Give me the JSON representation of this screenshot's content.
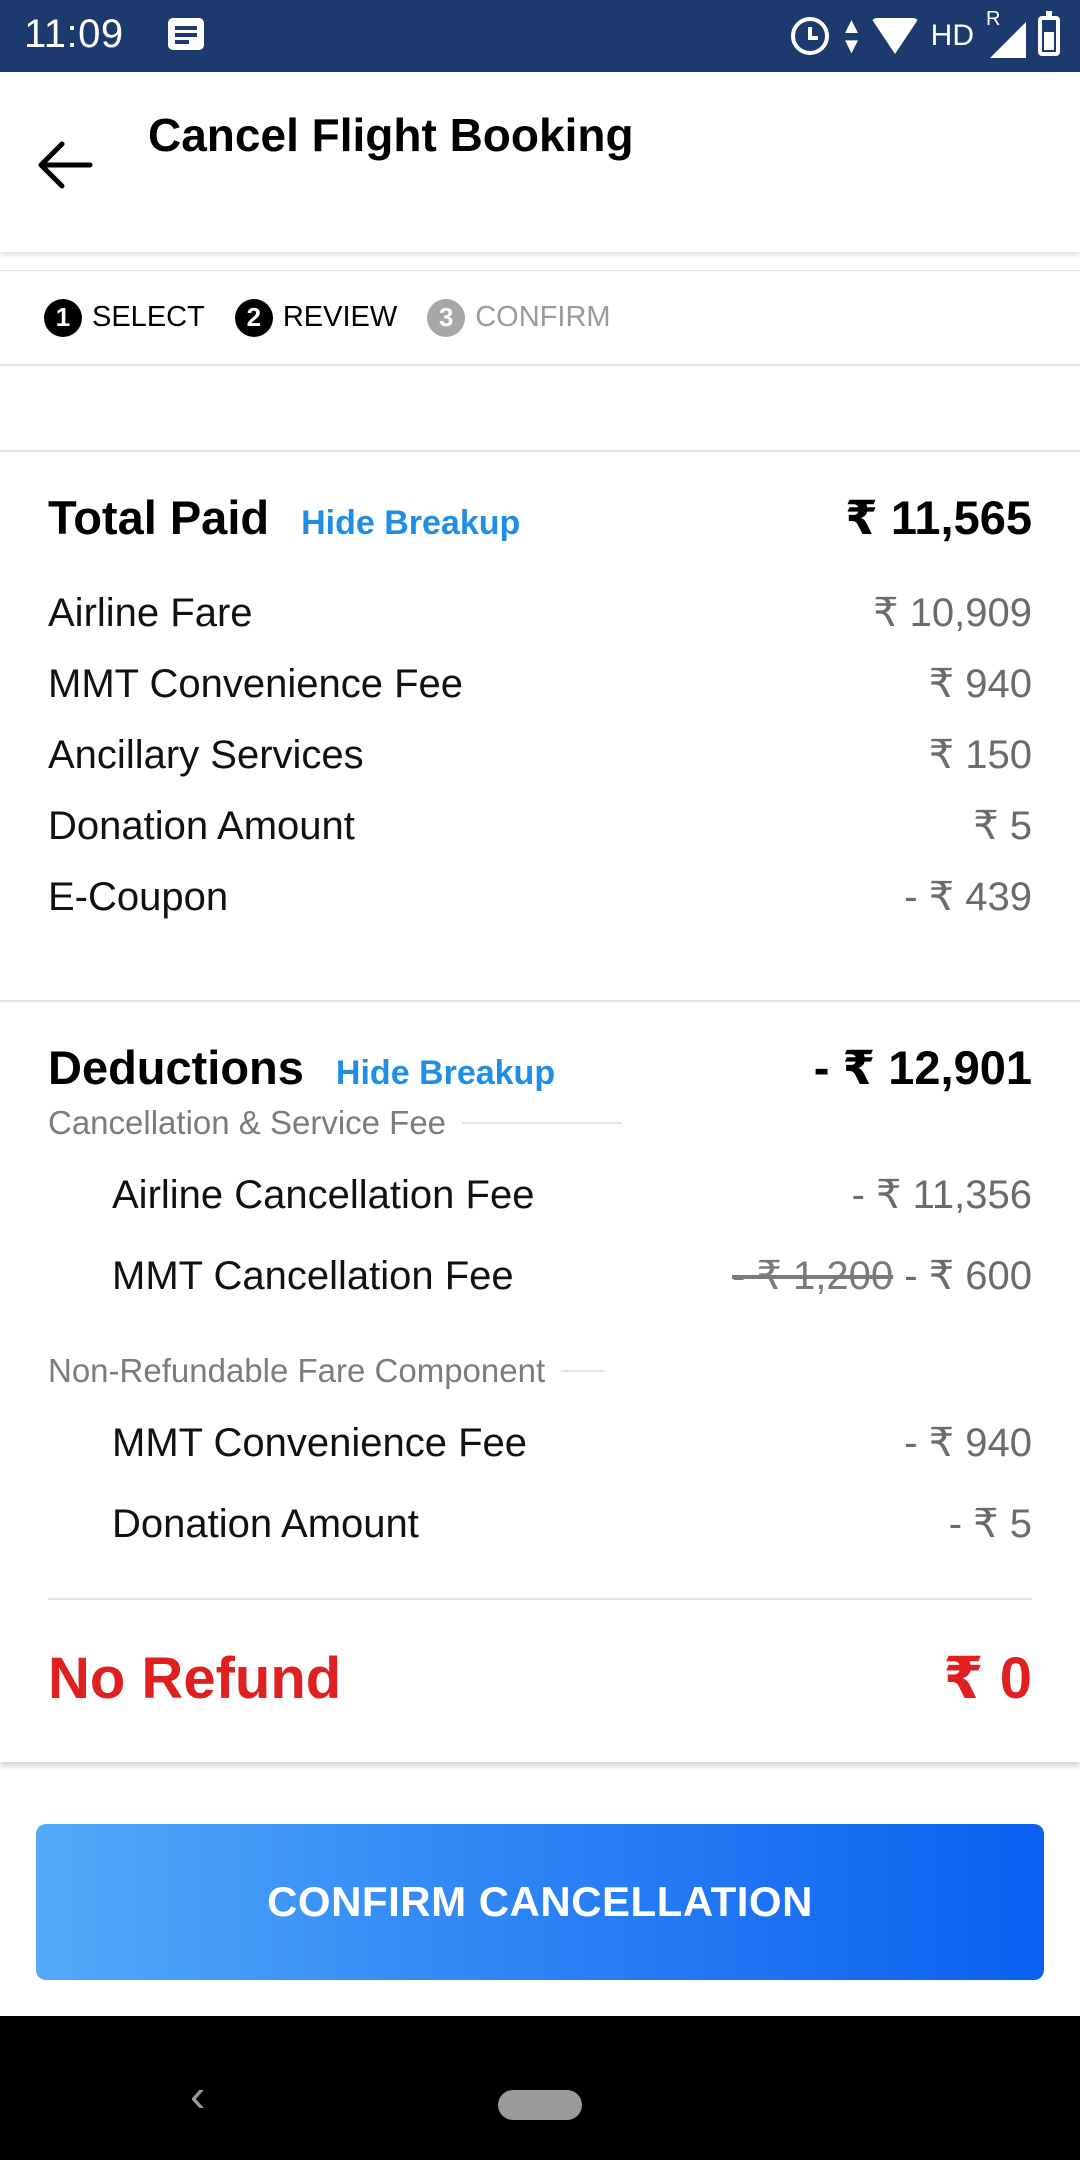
{
  "status_bar": {
    "time": "11:09",
    "network_label": "HD",
    "roaming_label": "R"
  },
  "header": {
    "title": "Cancel Flight Booking"
  },
  "stepper": {
    "steps": [
      {
        "number": "1",
        "label": "SELECT",
        "state": "completed"
      },
      {
        "number": "2",
        "label": "REVIEW",
        "state": "active"
      },
      {
        "number": "3",
        "label": "CONFIRM",
        "state": "inactive"
      }
    ]
  },
  "total_paid": {
    "title": "Total Paid",
    "toggle_label": "Hide Breakup",
    "amount": "₹ 11,565",
    "items": [
      {
        "label": "Airline Fare",
        "value": "₹ 10,909"
      },
      {
        "label": "MMT Convenience Fee",
        "value": "₹ 940"
      },
      {
        "label": "Ancillary Services",
        "value": "₹ 150"
      },
      {
        "label": "Donation Amount",
        "value": "₹ 5"
      },
      {
        "label": "E-Coupon",
        "value": "- ₹ 439"
      }
    ]
  },
  "deductions": {
    "title": "Deductions",
    "toggle_label": "Hide Breakup",
    "amount": "- ₹ 12,901",
    "cancellation_group": {
      "label": "Cancellation & Service Fee",
      "items": [
        {
          "label": "Airline Cancellation Fee",
          "value": "- ₹ 11,356"
        },
        {
          "label": "MMT Cancellation Fee",
          "original_value": "- ₹ 1,200",
          "value": "- ₹ 600"
        }
      ]
    },
    "non_refundable_group": {
      "label": "Non-Refundable Fare Component",
      "items": [
        {
          "label": "MMT Convenience Fee",
          "value": "- ₹ 940"
        },
        {
          "label": "Donation Amount",
          "value": "- ₹ 5"
        }
      ]
    }
  },
  "refund": {
    "label": "No Refund",
    "amount": "₹ 0"
  },
  "actions": {
    "confirm_label": "CONFIRM CANCELLATION"
  },
  "colors": {
    "status_bar": "#1c3a6e",
    "link": "#1f8ee6",
    "refund": "#e02020",
    "button_start": "#53aaf9",
    "button_end": "#0a60f0"
  }
}
